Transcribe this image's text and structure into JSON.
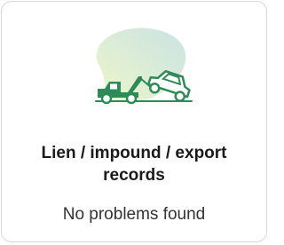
{
  "card": {
    "title": "Lien / impound / export records",
    "status": "No problems found",
    "icon": "tow-truck-icon",
    "colors": {
      "accent": "#2e8b57",
      "blob_light": "#e6f3c9",
      "blob_dark": "#cfe6e0",
      "title_text": "#1a1a1a",
      "status_text": "#333333",
      "border": "#d6d6d6"
    }
  }
}
